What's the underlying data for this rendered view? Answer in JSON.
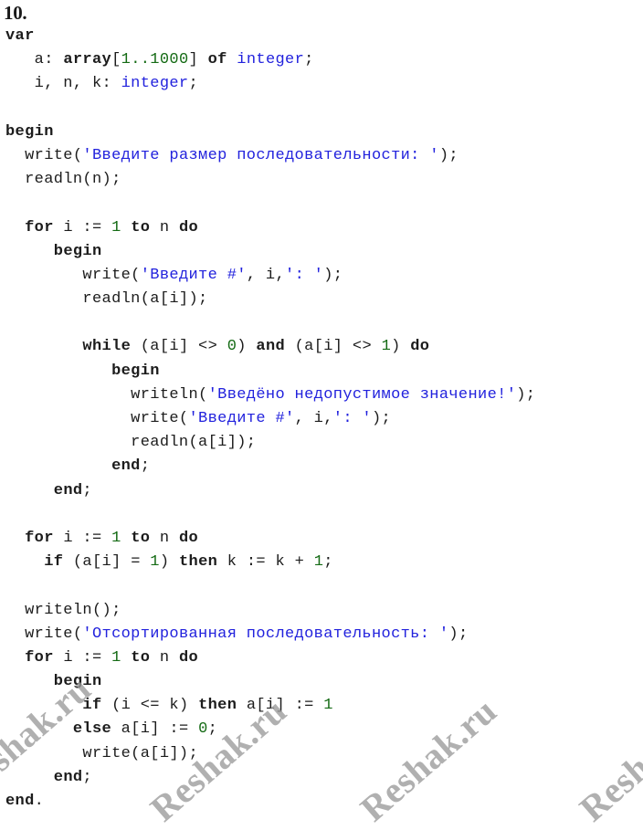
{
  "document": {
    "task_number": "10.",
    "language": "Pascal"
  },
  "colors": {
    "text": "#1c1c1c",
    "string": "#2222dd",
    "number": "#156b15",
    "type": "#2222dd",
    "watermark": "#9a9a9a",
    "background": "#ffffff"
  },
  "watermark": {
    "text": "Reshak.ru",
    "instances": [
      "Reshak.ru",
      "Reshak.ru",
      "Reshak.ru",
      "Reshak.ru"
    ]
  },
  "code": {
    "lines": [
      {
        "id": 1,
        "text": "var",
        "tokens": [
          {
            "t": "var",
            "c": "kw"
          }
        ]
      },
      {
        "id": 2,
        "text": "   a: array[1..1000] of integer;",
        "tokens": [
          {
            "t": "   a: ",
            "c": "plain"
          },
          {
            "t": "array",
            "c": "kw"
          },
          {
            "t": "[",
            "c": "plain"
          },
          {
            "t": "1..1000",
            "c": "num"
          },
          {
            "t": "] ",
            "c": "plain"
          },
          {
            "t": "of",
            "c": "kw"
          },
          {
            "t": " ",
            "c": "plain"
          },
          {
            "t": "integer",
            "c": "type"
          },
          {
            "t": ";",
            "c": "plain"
          }
        ]
      },
      {
        "id": 3,
        "text": "   i, n, k: integer;",
        "tokens": [
          {
            "t": "   i, n, k: ",
            "c": "plain"
          },
          {
            "t": "integer",
            "c": "type"
          },
          {
            "t": ";",
            "c": "plain"
          }
        ]
      },
      {
        "id": 4,
        "text": "",
        "tokens": []
      },
      {
        "id": 5,
        "text": "begin",
        "tokens": [
          {
            "t": "begin",
            "c": "kw"
          }
        ]
      },
      {
        "id": 6,
        "text": "  write('Введите размер последовательности: ');",
        "tokens": [
          {
            "t": "  write(",
            "c": "plain"
          },
          {
            "t": "'Введите размер последовательности: '",
            "c": "str"
          },
          {
            "t": ");",
            "c": "plain"
          }
        ]
      },
      {
        "id": 7,
        "text": "  readln(n);",
        "tokens": [
          {
            "t": "  readln(n);",
            "c": "plain"
          }
        ]
      },
      {
        "id": 8,
        "text": "",
        "tokens": []
      },
      {
        "id": 9,
        "text": "  for i := 1 to n do",
        "tokens": [
          {
            "t": "  ",
            "c": "plain"
          },
          {
            "t": "for",
            "c": "kw"
          },
          {
            "t": " i := ",
            "c": "plain"
          },
          {
            "t": "1",
            "c": "num"
          },
          {
            "t": " ",
            "c": "plain"
          },
          {
            "t": "to",
            "c": "kw"
          },
          {
            "t": " n ",
            "c": "plain"
          },
          {
            "t": "do",
            "c": "kw"
          }
        ]
      },
      {
        "id": 10,
        "text": "     begin",
        "tokens": [
          {
            "t": "     ",
            "c": "plain"
          },
          {
            "t": "begin",
            "c": "kw"
          }
        ]
      },
      {
        "id": 11,
        "text": "        write('Введите #', i,': ');",
        "tokens": [
          {
            "t": "        write(",
            "c": "plain"
          },
          {
            "t": "'Введите #'",
            "c": "str"
          },
          {
            "t": ", i,",
            "c": "plain"
          },
          {
            "t": "': '",
            "c": "str"
          },
          {
            "t": ");",
            "c": "plain"
          }
        ]
      },
      {
        "id": 12,
        "text": "        readln(a[i]);",
        "tokens": [
          {
            "t": "        readln(a[i]);",
            "c": "plain"
          }
        ]
      },
      {
        "id": 13,
        "text": "",
        "tokens": []
      },
      {
        "id": 14,
        "text": "        while (a[i] <> 0) and (a[i] <> 1) do",
        "tokens": [
          {
            "t": "        ",
            "c": "plain"
          },
          {
            "t": "while",
            "c": "kw"
          },
          {
            "t": " (a[i] <> ",
            "c": "plain"
          },
          {
            "t": "0",
            "c": "num"
          },
          {
            "t": ") ",
            "c": "plain"
          },
          {
            "t": "and",
            "c": "kw"
          },
          {
            "t": " (a[i] <> ",
            "c": "plain"
          },
          {
            "t": "1",
            "c": "num"
          },
          {
            "t": ") ",
            "c": "plain"
          },
          {
            "t": "do",
            "c": "kw"
          }
        ]
      },
      {
        "id": 15,
        "text": "           begin",
        "tokens": [
          {
            "t": "           ",
            "c": "plain"
          },
          {
            "t": "begin",
            "c": "kw"
          }
        ]
      },
      {
        "id": 16,
        "text": "             writeln('Введёно недопустимое значение!');",
        "tokens": [
          {
            "t": "             writeln(",
            "c": "plain"
          },
          {
            "t": "'Введёно недопустимое значение!'",
            "c": "str"
          },
          {
            "t": ");",
            "c": "plain"
          }
        ]
      },
      {
        "id": 17,
        "text": "             write('Введите #', i,': ');",
        "tokens": [
          {
            "t": "             write(",
            "c": "plain"
          },
          {
            "t": "'Введите #'",
            "c": "str"
          },
          {
            "t": ", i,",
            "c": "plain"
          },
          {
            "t": "': '",
            "c": "str"
          },
          {
            "t": ");",
            "c": "plain"
          }
        ]
      },
      {
        "id": 18,
        "text": "             readln(a[i]);",
        "tokens": [
          {
            "t": "             readln(a[i]);",
            "c": "plain"
          }
        ]
      },
      {
        "id": 19,
        "text": "           end;",
        "tokens": [
          {
            "t": "           ",
            "c": "plain"
          },
          {
            "t": "end",
            "c": "kw"
          },
          {
            "t": ";",
            "c": "plain"
          }
        ]
      },
      {
        "id": 20,
        "text": "     end;",
        "tokens": [
          {
            "t": "     ",
            "c": "plain"
          },
          {
            "t": "end",
            "c": "kw"
          },
          {
            "t": ";",
            "c": "plain"
          }
        ]
      },
      {
        "id": 21,
        "text": "",
        "tokens": []
      },
      {
        "id": 22,
        "text": "  for i := 1 to n do",
        "tokens": [
          {
            "t": "  ",
            "c": "plain"
          },
          {
            "t": "for",
            "c": "kw"
          },
          {
            "t": " i := ",
            "c": "plain"
          },
          {
            "t": "1",
            "c": "num"
          },
          {
            "t": " ",
            "c": "plain"
          },
          {
            "t": "to",
            "c": "kw"
          },
          {
            "t": " n ",
            "c": "plain"
          },
          {
            "t": "do",
            "c": "kw"
          }
        ]
      },
      {
        "id": 23,
        "text": "    if (a[i] = 1) then k := k + 1;",
        "tokens": [
          {
            "t": "    ",
            "c": "plain"
          },
          {
            "t": "if",
            "c": "kw"
          },
          {
            "t": " (a[i] = ",
            "c": "plain"
          },
          {
            "t": "1",
            "c": "num"
          },
          {
            "t": ") ",
            "c": "plain"
          },
          {
            "t": "then",
            "c": "kw"
          },
          {
            "t": " k := k + ",
            "c": "plain"
          },
          {
            "t": "1",
            "c": "num"
          },
          {
            "t": ";",
            "c": "plain"
          }
        ]
      },
      {
        "id": 24,
        "text": "",
        "tokens": []
      },
      {
        "id": 25,
        "text": "  writeln();",
        "tokens": [
          {
            "t": "  writeln();",
            "c": "plain"
          }
        ]
      },
      {
        "id": 26,
        "text": "  write('Отсортированная последовательность: ');",
        "tokens": [
          {
            "t": "  write(",
            "c": "plain"
          },
          {
            "t": "'Отсортированная последовательность: '",
            "c": "str"
          },
          {
            "t": ");",
            "c": "plain"
          }
        ]
      },
      {
        "id": 27,
        "text": "  for i := 1 to n do",
        "tokens": [
          {
            "t": "  ",
            "c": "plain"
          },
          {
            "t": "for",
            "c": "kw"
          },
          {
            "t": " i := ",
            "c": "plain"
          },
          {
            "t": "1",
            "c": "num"
          },
          {
            "t": " ",
            "c": "plain"
          },
          {
            "t": "to",
            "c": "kw"
          },
          {
            "t": " n ",
            "c": "plain"
          },
          {
            "t": "do",
            "c": "kw"
          }
        ]
      },
      {
        "id": 28,
        "text": "     begin",
        "tokens": [
          {
            "t": "     ",
            "c": "plain"
          },
          {
            "t": "begin",
            "c": "kw"
          }
        ]
      },
      {
        "id": 29,
        "text": "        if (i <= k) then a[i] := 1",
        "tokens": [
          {
            "t": "        ",
            "c": "plain"
          },
          {
            "t": "if",
            "c": "kw"
          },
          {
            "t": " (i <= k) ",
            "c": "plain"
          },
          {
            "t": "then",
            "c": "kw"
          },
          {
            "t": " a[i] := ",
            "c": "plain"
          },
          {
            "t": "1",
            "c": "num"
          }
        ]
      },
      {
        "id": 30,
        "text": "       else a[i] := 0;",
        "tokens": [
          {
            "t": "       ",
            "c": "plain"
          },
          {
            "t": "else",
            "c": "kw"
          },
          {
            "t": " a[i] := ",
            "c": "plain"
          },
          {
            "t": "0",
            "c": "num"
          },
          {
            "t": ";",
            "c": "plain"
          }
        ]
      },
      {
        "id": 31,
        "text": "        write(a[i]);",
        "tokens": [
          {
            "t": "        write(a[i]);",
            "c": "plain"
          }
        ]
      },
      {
        "id": 32,
        "text": "     end;",
        "tokens": [
          {
            "t": "     ",
            "c": "plain"
          },
          {
            "t": "end",
            "c": "kw"
          },
          {
            "t": ";",
            "c": "plain"
          }
        ]
      },
      {
        "id": 33,
        "text": "end.",
        "tokens": [
          {
            "t": "end",
            "c": "kw"
          },
          {
            "t": ".",
            "c": "plain"
          }
        ]
      }
    ]
  }
}
